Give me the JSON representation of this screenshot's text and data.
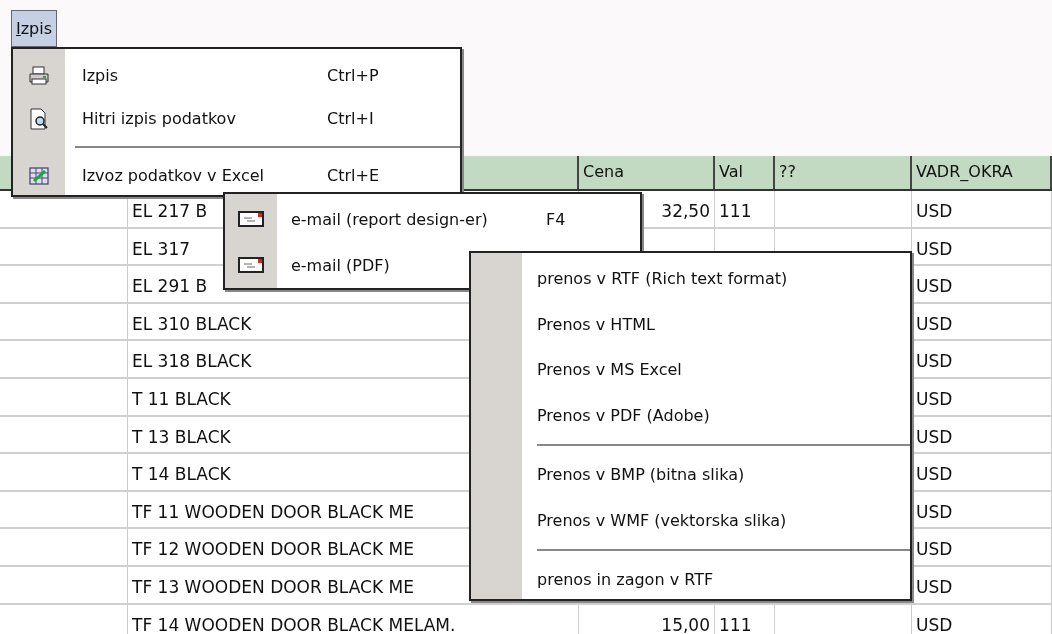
{
  "menu_bar": [
    {
      "label": "Izpis",
      "selected": true
    }
  ],
  "menu": {
    "items": [
      {
        "kind": "item",
        "label": "Izpis",
        "shortcut": "Ctrl+P"
      },
      {
        "kind": "item",
        "label": "Hitri izpis podatkov",
        "shortcut": "Ctrl+I"
      },
      {
        "kind": "separator"
      },
      {
        "kind": "item",
        "label": "Izvoz podatkov v Excel",
        "shortcut": "Ctrl+E"
      }
    ]
  },
  "submenu": {
    "items": [
      {
        "label": "e-mail (report design-er)",
        "shortcut": "F4"
      },
      {
        "label": "e-mail (PDF)"
      }
    ]
  },
  "context_menu": {
    "items": [
      {
        "kind": "item",
        "label": "prenos v RTF (Rich text format)"
      },
      {
        "kind": "item",
        "label": "Prenos v HTML"
      },
      {
        "kind": "item",
        "label": "Prenos v MS Excel"
      },
      {
        "kind": "item",
        "label": "Prenos v PDF (Adobe)"
      },
      {
        "kind": "separator"
      },
      {
        "kind": "item",
        "label": "Prenos v BMP (bitna slika)"
      },
      {
        "kind": "item",
        "label": "Prenos v WMF (vektorska slika)"
      },
      {
        "kind": "separator"
      },
      {
        "kind": "item",
        "label": "prenos in zagon v RTF"
      }
    ]
  },
  "table": {
    "columns": [
      "Cena",
      "Val",
      "??",
      "VADR_OKRA"
    ],
    "rows": [
      {
        "name": "EL 217  B",
        "price": "32,50",
        "val": "111",
        "currency": "USD"
      },
      {
        "name": "EL 317",
        "currency": "USD"
      },
      {
        "name": "EL 291  B",
        "currency": "USD"
      },
      {
        "name": "EL 310  BLACK",
        "currency": "USD"
      },
      {
        "name": "EL 318  BLACK",
        "currency": "USD"
      },
      {
        "name": "T 11 BLACK",
        "currency": "USD"
      },
      {
        "name": "T 13 BLACK",
        "currency": "USD"
      },
      {
        "name": "T 14 BLACK",
        "currency": "USD"
      },
      {
        "name": "TF 11 WOODEN DOOR BLACK ME",
        "currency": "USD"
      },
      {
        "name": "TF 12 WOODEN DOOR BLACK ME",
        "currency": "USD"
      },
      {
        "name": "TF 13 WOODEN DOOR BLACK ME",
        "currency": "USD"
      },
      {
        "name": "TF 14 WOODEN DOOR BLACK MELAM.",
        "price": "15,00",
        "val": "111",
        "currency": "USD"
      }
    ]
  }
}
